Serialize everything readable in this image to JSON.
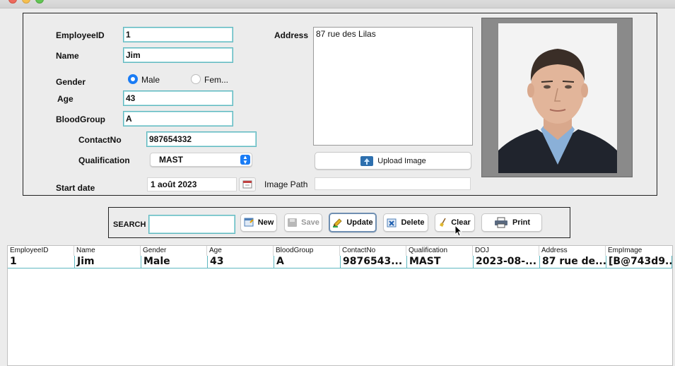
{
  "form": {
    "employee_id_label": "EmployeeID",
    "employee_id_value": "1",
    "name_label": "Name",
    "name_value": "Jim",
    "gender_label": "Gender",
    "gender_male": "Male",
    "gender_female": "Fem...",
    "gender_selected": "Male",
    "age_label": "Age",
    "age_value": "43",
    "bloodgroup_label": "BloodGroup",
    "bloodgroup_value": "A",
    "contact_label": "ContactNo",
    "contact_value": "987654332",
    "qualification_label": "Qualification",
    "qualification_value": "MAST",
    "startdate_label": "Start date",
    "startdate_value": "1 août 2023",
    "address_label": "Address",
    "address_value": "87 rue des Lilas",
    "upload_label": "Upload Image",
    "imagepath_label": "Image Path",
    "imagepath_value": ""
  },
  "toolbar": {
    "search_label": "SEARCH",
    "search_value": "",
    "new_label": "New",
    "save_label": "Save",
    "update_label": "Update",
    "delete_label": "Delete",
    "clear_label": "Clear",
    "print_label": "Print"
  },
  "table": {
    "columns": [
      "EmployeeID",
      "Name",
      "Gender",
      "Age",
      "BloodGroup",
      "ContactNo",
      "Qualification",
      "DOJ",
      "Address",
      "EmpImage"
    ],
    "rows": [
      [
        "1",
        "Jim",
        "Male",
        "43",
        "A",
        "9876543...",
        "MAST",
        "2023-08-...",
        "87 rue de...",
        "[B@743d9..."
      ]
    ]
  },
  "icons": {
    "calendar": "calendar-icon",
    "upload": "upload-icon",
    "new": "new-document-icon",
    "save": "floppy-disk-icon",
    "update": "pencil-icon",
    "delete": "delete-x-icon",
    "clear": "broom-icon",
    "print": "printer-icon"
  },
  "colors": {
    "accent": "#1a7cf5",
    "field_border": "#5fb8c0",
    "background": "#ececec"
  }
}
